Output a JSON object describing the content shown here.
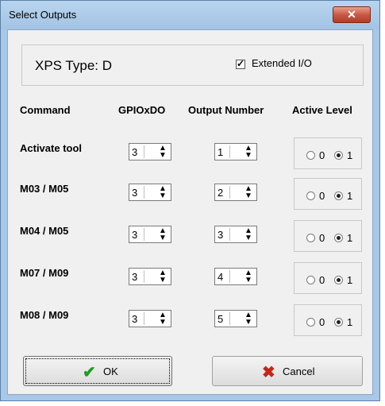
{
  "window": {
    "title": "Select Outputs",
    "close_icon": "close-icon"
  },
  "xps": {
    "label": "XPS Type:  D",
    "extended_checked": true,
    "extended_label": "Extended I/O"
  },
  "headers": {
    "command": "Command",
    "gpio": "GPIOxDO",
    "output": "Output Number",
    "active": "Active Level"
  },
  "rows": [
    {
      "command": "Activate tool",
      "gpio": "3",
      "output": "1",
      "level": "1"
    },
    {
      "command": "M03 / M05",
      "gpio": "3",
      "output": "2",
      "level": "1"
    },
    {
      "command": "M04 / M05",
      "gpio": "3",
      "output": "3",
      "level": "1"
    },
    {
      "command": "M07 / M09",
      "gpio": "3",
      "output": "4",
      "level": "1"
    },
    {
      "command": "M08 / M09",
      "gpio": "3",
      "output": "5",
      "level": "1"
    }
  ],
  "radio_labels": {
    "zero": "0",
    "one": "1"
  },
  "buttons": {
    "ok": "OK",
    "cancel": "Cancel"
  },
  "colors": {
    "ok_icon": "#1e9e1e",
    "cancel_icon": "#c0281c",
    "titlebar": "#a9c7e6"
  }
}
